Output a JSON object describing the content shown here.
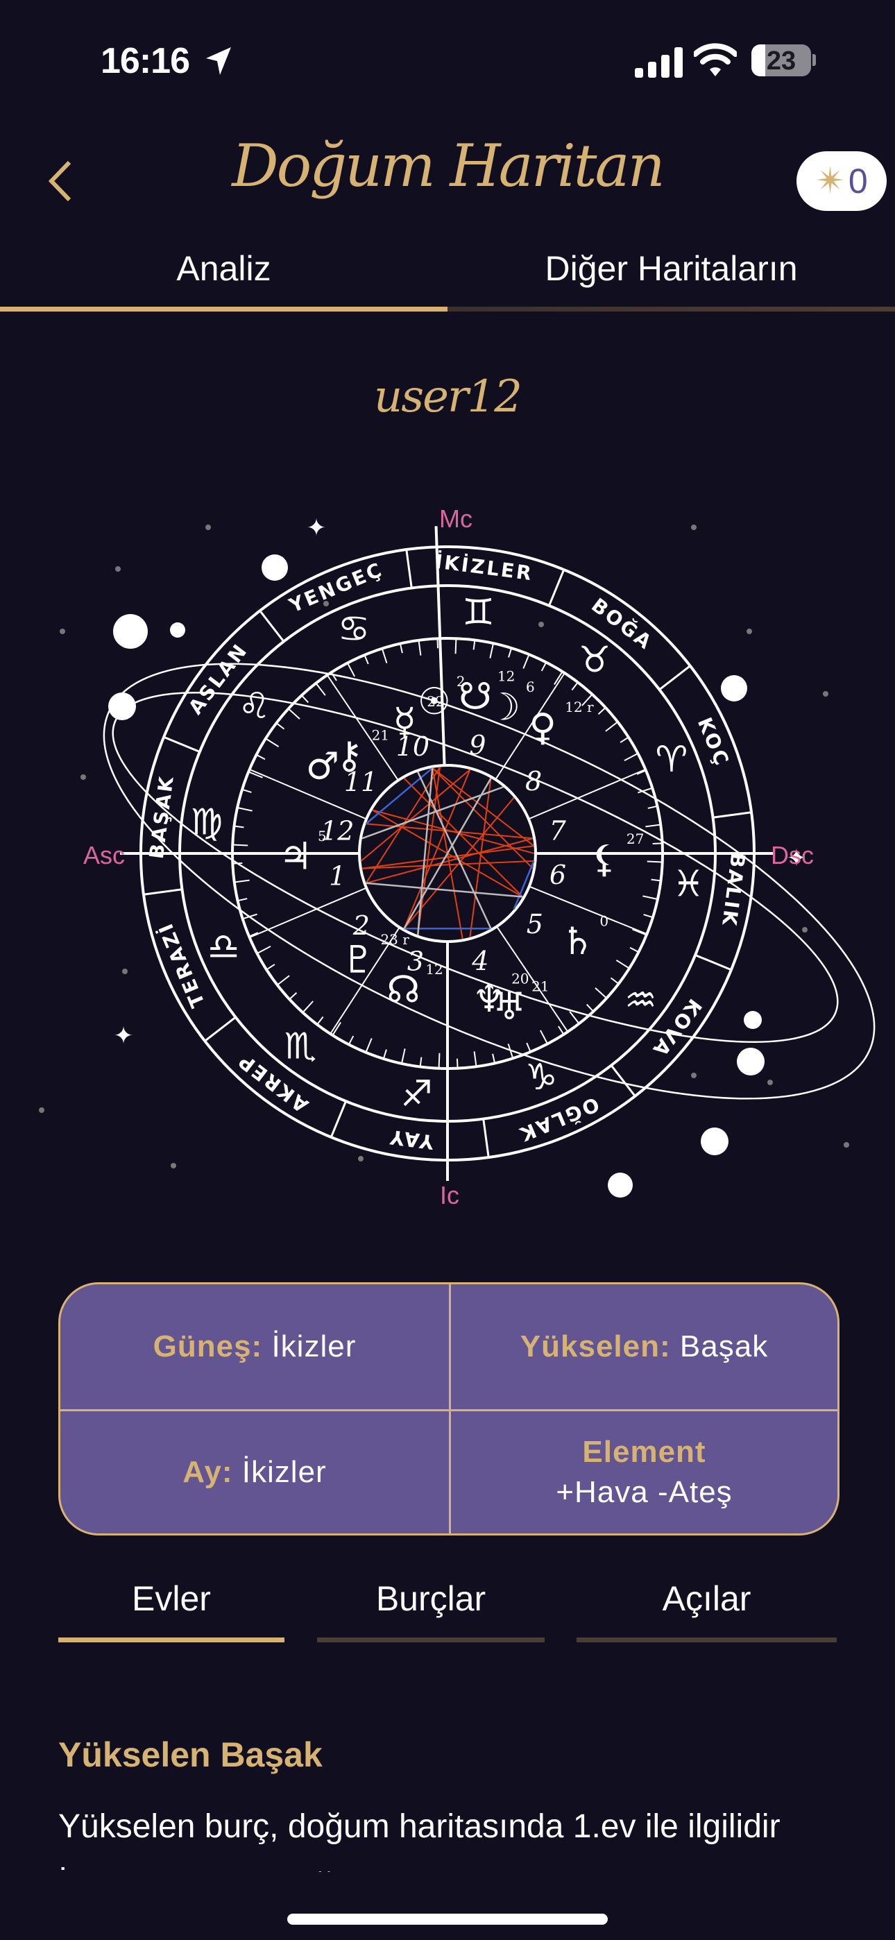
{
  "status_bar": {
    "time": "16:16",
    "battery": "23"
  },
  "header": {
    "title": "Doğum Haritan",
    "credits": "0",
    "credit_icon": "star-icon",
    "back_icon": "chevron-left-icon"
  },
  "tabs": [
    {
      "label": "Analiz",
      "active": true
    },
    {
      "label": "Diğer Haritaların",
      "active": false
    }
  ],
  "username": "user12",
  "chart": {
    "angles": {
      "mc": "Mc",
      "ic": "Ic",
      "asc": "Asc",
      "dsc": "Dsc"
    },
    "signs": [
      {
        "name": "İKİZLER",
        "glyph": "♊"
      },
      {
        "name": "YENGEÇ",
        "glyph": "♋"
      },
      {
        "name": "ASLAN",
        "glyph": "♌"
      },
      {
        "name": "BAŞAK",
        "glyph": "♍"
      },
      {
        "name": "TERAZİ",
        "glyph": "♎"
      },
      {
        "name": "AKREP",
        "glyph": "♏"
      },
      {
        "name": "YAY",
        "glyph": "♐"
      },
      {
        "name": "OĞLAK",
        "glyph": "♑"
      },
      {
        "name": "KOVA",
        "glyph": "♒"
      },
      {
        "name": "BALIK",
        "glyph": "♓"
      },
      {
        "name": "KOÇ",
        "glyph": "♈"
      },
      {
        "name": "BOĞA",
        "glyph": "♉"
      }
    ],
    "houses": [
      "1",
      "2",
      "3",
      "4",
      "5",
      "6",
      "7",
      "8",
      "9",
      "10",
      "11",
      "12"
    ],
    "planets": [
      {
        "glyph": "☉",
        "degree": "2"
      },
      {
        "glyph": "☋",
        "degree": "12"
      },
      {
        "glyph": "☽",
        "degree": "6"
      },
      {
        "glyph": "☿",
        "degree": "22"
      },
      {
        "glyph": "♀",
        "degree": "12 r"
      },
      {
        "glyph": "⚷",
        "degree": "21"
      },
      {
        "glyph": "♂",
        "degree": ""
      },
      {
        "glyph": "♃",
        "degree": "5"
      },
      {
        "glyph": "♇",
        "degree": "23 r"
      },
      {
        "glyph": "☊",
        "degree": "12"
      },
      {
        "glyph": "♆",
        "degree": "20"
      },
      {
        "glyph": "♅",
        "degree": "21"
      },
      {
        "glyph": "♄",
        "degree": "0"
      },
      {
        "glyph": "⚸",
        "degree": "27"
      }
    ],
    "colors": {
      "ring": "#ffffff",
      "angle_label": "#d9679a",
      "aspect_hard": "#e0400f",
      "aspect_soft": "#3a63d8",
      "aspect_minor": "#bbbbbb"
    }
  },
  "summary": {
    "sun": {
      "label": "Güneş:",
      "value": "İkizler"
    },
    "rising": {
      "label": "Yükselen:",
      "value": "Başak"
    },
    "moon": {
      "label": "Ay:",
      "value": "İkizler"
    },
    "element": {
      "label": "Element",
      "value": "+Hava -Ateş"
    }
  },
  "sub_tabs": [
    {
      "label": "Evler",
      "active": true
    },
    {
      "label": "Burçlar",
      "active": false
    },
    {
      "label": "Açılar",
      "active": false
    }
  ],
  "content": {
    "heading": "Yükselen Başak",
    "text": "Yükselen burç, doğum haritasında 1.ev ile ilgilidir İnsanlarda bıraktığın ilk izlenimi ve"
  },
  "theme": {
    "background": "#100e1f",
    "gold": "#d6b372",
    "card": "#635592"
  }
}
